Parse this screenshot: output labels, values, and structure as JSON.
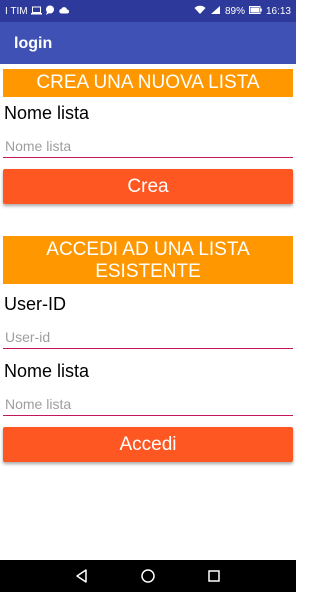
{
  "status_bar": {
    "carrier": "I TIM",
    "battery": "89%",
    "time": "16:13"
  },
  "app_bar": {
    "title": "login"
  },
  "create_section": {
    "header": "CREA UNA NUOVA LISTA",
    "name_label": "Nome lista",
    "name_placeholder": "Nome lista",
    "button_label": "Crea"
  },
  "access_section": {
    "header_line1": "ACCEDI AD UNA LISTA",
    "header_line2": "ESISTENTE",
    "userid_label": "User-ID",
    "userid_placeholder": "User-id",
    "name_label": "Nome lista",
    "name_placeholder": "Nome lista",
    "button_label": "Accedi"
  },
  "nav_bar": {
    "back_icon": "back-triangle-icon",
    "home_icon": "home-circle-icon",
    "recents_icon": "recents-square-icon"
  },
  "colors": {
    "status_bar": "#2d3a9b",
    "app_bar": "#3f51b5",
    "section_header": "#ff9800",
    "button": "#ff5722",
    "input_underline": "#c2185b"
  }
}
